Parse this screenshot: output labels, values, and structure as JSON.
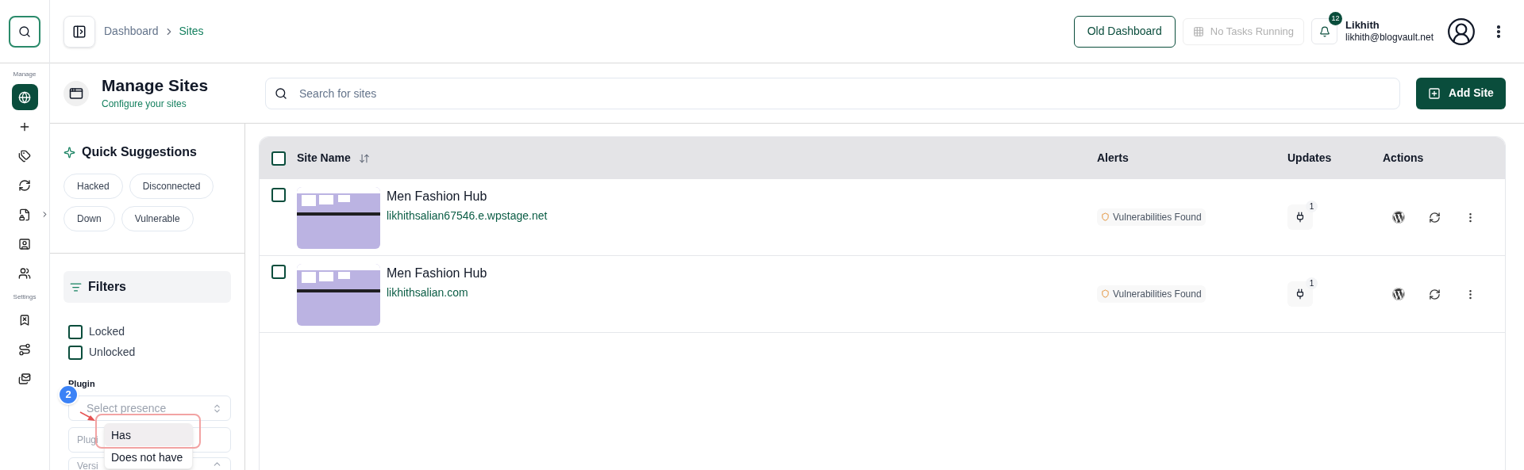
{
  "sidebar": {
    "sections": [
      {
        "label": "Manage",
        "items": [
          {
            "selected": true
          },
          {
            "selected": false
          },
          {
            "selected": false
          },
          {
            "selected": false
          },
          {
            "selected": false,
            "expandable": true
          },
          {
            "selected": false
          },
          {
            "selected": false
          }
        ]
      },
      {
        "label": "Settings",
        "items": [
          {
            "selected": false
          },
          {
            "selected": false
          },
          {
            "selected": false
          }
        ]
      }
    ]
  },
  "header": {
    "breadcrumb": [
      {
        "label": "Dashboard",
        "current": false
      },
      {
        "label": "Sites",
        "current": true
      }
    ],
    "old_dashboard": "Old Dashboard",
    "tasks": {
      "label": "No Tasks Running",
      "disabled": true
    },
    "notifications": "12",
    "user": {
      "name": "Likhith",
      "email": "likhith@blogvault.net"
    }
  },
  "page": {
    "title": "Manage Sites",
    "subtitle": "Configure your sites",
    "search": {
      "placeholder": "Search for sites"
    },
    "add_button": "Add Site"
  },
  "quick_suggestions": {
    "title": "Quick Suggestions",
    "chips": [
      "Hacked",
      "Disconnected",
      "Down",
      "Vulnerable"
    ]
  },
  "filters": {
    "title": "Filters",
    "lock_status": [
      {
        "label": "Locked",
        "checked": false
      },
      {
        "label": "Unlocked",
        "checked": false
      }
    ],
    "plugin": {
      "label": "Plugin",
      "presence_placeholder": "Select presence",
      "name_placeholder": "Plugi",
      "version_placeholder": "Versi"
    },
    "presence_menu": [
      {
        "label": "Has",
        "selected": true
      },
      {
        "label": "Does not have",
        "selected": false
      }
    ],
    "step_marker": "2"
  },
  "table": {
    "select_all": false,
    "columns": [
      "Site Name",
      "Alerts",
      "Updates",
      "Actions"
    ],
    "rows": [
      {
        "checked": false,
        "name": "Men Fashion Hub",
        "url": "likhithsalian67546.e.wpstage.net",
        "alert": "Vulnerabilities Found",
        "updates": "1"
      },
      {
        "checked": false,
        "name": "Men Fashion Hub",
        "url": "likhithsalian.com",
        "alert": "Vulnerabilities Found",
        "updates": "1"
      }
    ]
  }
}
